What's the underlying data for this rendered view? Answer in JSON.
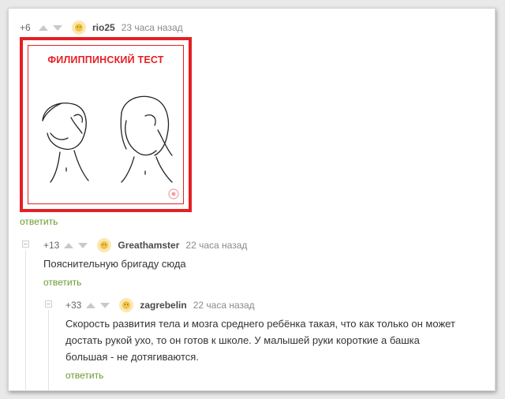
{
  "comments": [
    {
      "rating": "+6",
      "username": "rio25",
      "time": "23 часа назад",
      "image_title": "ФИЛИППИНСКИЙ ТЕСТ",
      "reply_label": "ответить"
    },
    {
      "rating": "+13",
      "username": "Greathamster",
      "time": "22 часа назад",
      "text": "Пояснительную бригаду сюда",
      "reply_label": "ответить"
    },
    {
      "rating": "+33",
      "username": "zagrebelin",
      "time": "22 часа назад",
      "text_lines": [
        "Скорость развития тела и мозга среднего ребёнка такая, что как только он может",
        "достать рукой ухо, то он готов к школе. У малышей руки короткие а башка",
        "большая - не дотягиваются."
      ],
      "reply_label": "ответить"
    }
  ],
  "colors": {
    "accent_red": "#e51f24",
    "reply_green": "#6a9b2e"
  },
  "icons": [
    "arrow-up-icon",
    "arrow-down-icon",
    "avatar-icon",
    "collapse-icon"
  ]
}
